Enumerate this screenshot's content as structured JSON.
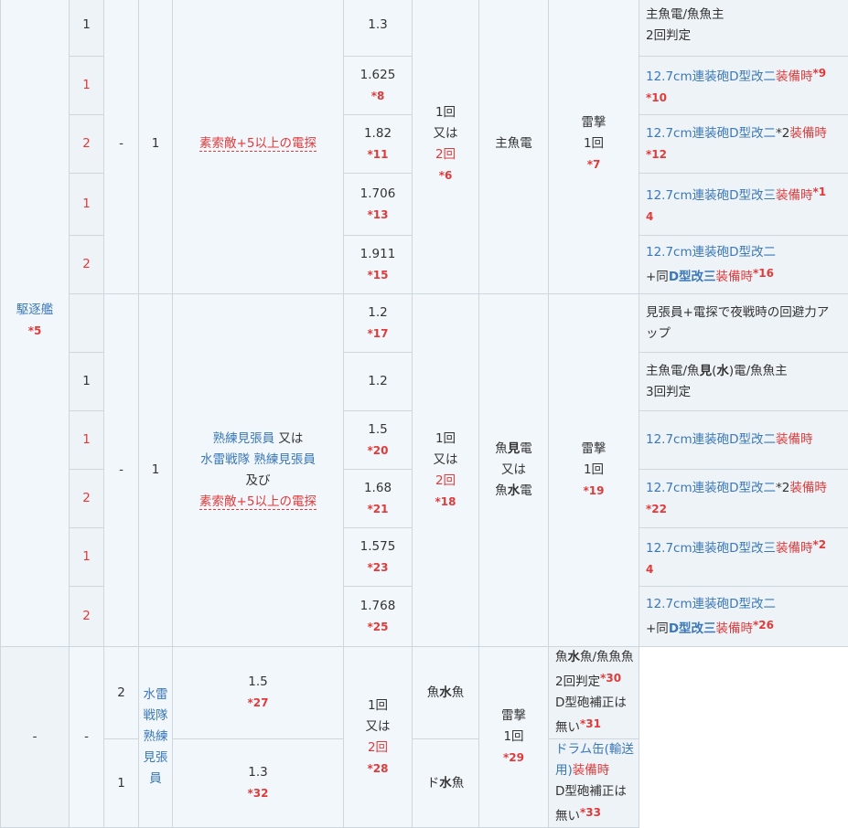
{
  "ship": {
    "name": "駆逐艦",
    "note": "*5"
  },
  "g1": {
    "c3": "-",
    "c4": "1",
    "cond": "素索敵+5以上の電探",
    "times_a": "1回",
    "times_b": "又は",
    "times_c": "2回",
    "times_note": "*6",
    "equip": "主魚電",
    "type_a": "雷撃",
    "type_b": "1回",
    "type_note": "*7",
    "rows": [
      {
        "n": "1",
        "mult": "1.3",
        "mult_note": "",
        "note_a": "主魚電/魚魚主",
        "note_b": "2回判定"
      },
      {
        "n": "1",
        "mult": "1.625",
        "mult_note": "*8",
        "note_a": "12.7cm連装砲D型改二",
        "note_b": "装備時",
        "note_c": "*9",
        "note_d": "*10"
      },
      {
        "n": "2",
        "mult": "1.82",
        "mult_note": "*11",
        "note_a": "12.7cm連装砲D型改二",
        "note_b": "*2",
        "note_c": "装備時",
        "note_d": "*12"
      },
      {
        "n": "1",
        "mult": "1.706",
        "mult_note": "*13",
        "note_a": "12.7cm連装砲D型改三",
        "note_b": "装備時",
        "note_c": "*1",
        "note_d": "4"
      },
      {
        "n": "2",
        "mult": "1.911",
        "mult_note": "*15",
        "note_a": "12.7cm連装砲D型改二",
        "note_b": "+同",
        "note_c": "D型改三",
        "note_d": "装備時",
        "note_e": "*16"
      }
    ]
  },
  "g2": {
    "c3": "-",
    "c4": "1",
    "cond_a": "熟練見張員",
    "cond_b": "又は",
    "cond_c": "水雷戦隊 熟練見張員",
    "cond_d": "及び",
    "cond_e": "素索敵+5以上の電探",
    "times_a": "1回",
    "times_b": "又は",
    "times_c": "2回",
    "times_note": "*18",
    "equip_a1": "魚",
    "equip_a2": "見",
    "equip_a3": "電",
    "equip_b": "又は",
    "equip_c1": "魚",
    "equip_c2": "水",
    "equip_c3": "電",
    "type_a": "雷撃",
    "type_b": "1回",
    "type_note": "*19",
    "rows": [
      {
        "n": "",
        "mult": "1.2",
        "mult_note": "*17",
        "note_a": "見張員+電探で夜戦時の回避力ア",
        "note_b": "ップ"
      },
      {
        "n": "1",
        "mult": "1.2",
        "mult_note": "",
        "note_a": "主魚電/魚",
        "note_b": "見",
        "note_c": "(",
        "note_d": "水",
        "note_e": ")電/魚魚主",
        "note_f": "3回判定"
      },
      {
        "n": "1",
        "mult": "1.5",
        "mult_note": "*20",
        "note_a": "12.7cm連装砲D型改二",
        "note_b": "装備時"
      },
      {
        "n": "2",
        "mult": "1.68",
        "mult_note": "*21",
        "note_a": "12.7cm連装砲D型改二",
        "note_b": "*2",
        "note_c": "装備時",
        "note_d": "*22"
      },
      {
        "n": "1",
        "mult": "1.575",
        "mult_note": "*23",
        "note_a": "12.7cm連装砲D型改三",
        "note_b": "装備時",
        "note_c": "*2",
        "note_d": "4"
      },
      {
        "n": "2",
        "mult": "1.768",
        "mult_note": "*25",
        "note_a": "12.7cm連装砲D型改二",
        "note_b": "+同",
        "note_c": "D型改三",
        "note_d": "装備時",
        "note_e": "*26"
      }
    ]
  },
  "g3": {
    "c2": "-",
    "c3": "-",
    "cond": "水雷戦隊 熟練見張員",
    "type_a": "雷撃",
    "type_b": "1回",
    "type_note": "*29",
    "rows": [
      {
        "c4": "2",
        "mult": "1.5",
        "mult_note": "*27",
        "times_a": "1回",
        "times_b": "又は",
        "times_c": "2回",
        "times_note": "*28",
        "equip_a": "魚",
        "equip_b": "水",
        "equip_c": "魚",
        "note_a": "魚",
        "note_b": "水",
        "note_c": "魚/魚魚魚 2回判定",
        "note_d": "*30",
        "note_e": "D型砲補正は無い",
        "note_f": "*31"
      },
      {
        "c4": "1",
        "mult": "1.3",
        "mult_note": "*32",
        "equip_a": "ド",
        "equip_b": "水",
        "equip_c": "魚",
        "note_a": "ドラム缶(輸送用)",
        "note_b": "装備時",
        "note_c": "D型砲補正は無い",
        "note_d": "*33"
      }
    ]
  }
}
